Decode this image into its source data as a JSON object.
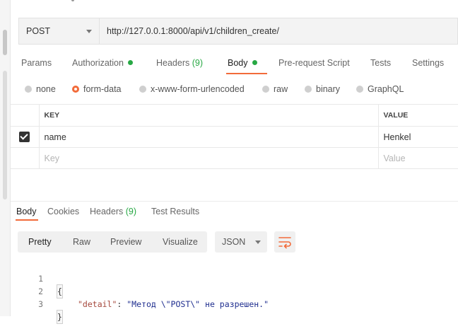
{
  "request": {
    "method": "POST",
    "url": "http://127.0.0.1:8000/api/v1/children_create/"
  },
  "request_tabs": {
    "params": "Params",
    "authorization": "Authorization",
    "headers": "Headers",
    "headers_count": "(9)",
    "body": "Body",
    "prerequest": "Pre-request Script",
    "tests": "Tests",
    "settings": "Settings"
  },
  "body_types": {
    "none": "none",
    "form_data": "form-data",
    "urlencoded": "x-www-form-urlencoded",
    "raw": "raw",
    "binary": "binary",
    "graphql": "GraphQL",
    "selected": "form-data"
  },
  "form_table": {
    "key_header": "KEY",
    "value_header": "VALUE",
    "rows": [
      {
        "checked": true,
        "key": "name",
        "value": "Henkel"
      }
    ],
    "placeholder_key": "Key",
    "placeholder_value": "Value"
  },
  "response_tabs": {
    "body": "Body",
    "cookies": "Cookies",
    "headers": "Headers",
    "headers_count": "(9)",
    "test_results": "Test Results"
  },
  "view_modes": {
    "pretty": "Pretty",
    "raw": "Raw",
    "preview": "Preview",
    "visualize": "Visualize",
    "format": "JSON"
  },
  "response_body": {
    "line1_no": "1",
    "line2_no": "2",
    "line3_no": "3",
    "open_brace": "{",
    "key": "\"detail\"",
    "colon": ": ",
    "value": "\"Метод \\\"POST\\\" не разрешен.\"",
    "close_brace": "}"
  },
  "colors": {
    "accent": "#f26b3a",
    "status_green": "#27a844"
  }
}
